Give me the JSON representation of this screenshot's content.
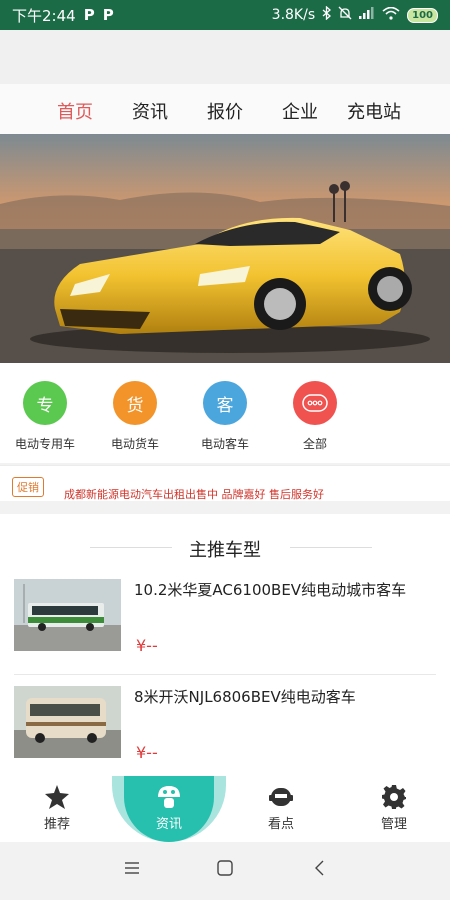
{
  "status_bar": {
    "time": "下午2:44",
    "app_icons": [
      "P",
      "P"
    ],
    "network_speed": "3.8K/s",
    "battery": "100"
  },
  "top_nav": {
    "tabs": [
      "首页",
      "资讯",
      "报价",
      "企业",
      "充电站"
    ],
    "active": "首页"
  },
  "categories": [
    {
      "icon_char": "专",
      "label": "电动专用车",
      "color": "#5bc84f"
    },
    {
      "icon_char": "货",
      "label": "电动货车",
      "color": "#f2942a"
    },
    {
      "icon_char": "客",
      "label": "电动客车",
      "color": "#4aa6dc"
    },
    {
      "icon_char": "ooo",
      "label": "全部",
      "color": "#f0524f"
    }
  ],
  "promo": {
    "tag": "促销",
    "text": "成都新能源电动汽车出租出售中 品牌嘉好 售后服务好"
  },
  "featured": {
    "heading": "主推车型",
    "items": [
      {
        "title": "10.2米华夏AC6100BEV纯电动城市客车",
        "price": "¥--",
        "thumb": "green-city-bus"
      },
      {
        "title": "8米开沃NJL6806BEV纯电动客车",
        "price": "¥--",
        "thumb": "tan-coach-bus"
      }
    ]
  },
  "bottom_nav": [
    {
      "label": "推荐",
      "icon": "star-icon"
    },
    {
      "label": "资讯",
      "icon": "mushroom-icon"
    },
    {
      "label": "看点",
      "icon": "robot-icon"
    },
    {
      "label": "管理",
      "icon": "gear-icon"
    }
  ],
  "colors": {
    "status_bar": "#1c6b47",
    "active_tab": "#e05a5a",
    "accent": "#27bfae",
    "price": "#e03b3b"
  }
}
